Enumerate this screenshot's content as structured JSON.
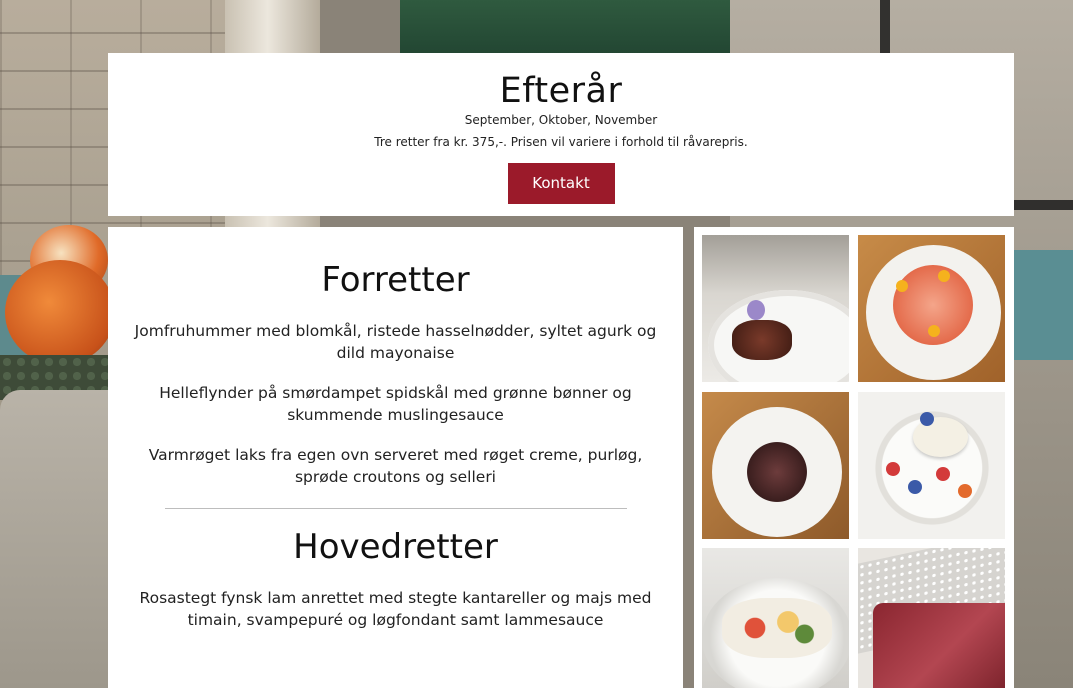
{
  "header": {
    "title": "Efterår",
    "months": "September, Oktober, November",
    "price_text": "Tre retter fra kr. 375,-. Prisen vil variere i forhold til råvarepris.",
    "contact_button": "Kontakt"
  },
  "menu": {
    "starters_heading": "Forretter",
    "starters": [
      "Jomfruhummer med blomkål, ristede hasselnødder, syltet agurk og dild mayonaise",
      "Helleflynder på smørdampet spidskål med grønne bønner og skummende muslingesauce",
      "Varmrøget laks fra egen ovn serveret med røget creme, purløg, sprøde croutons og selleri"
    ],
    "mains_heading": "Hovedretter",
    "mains": [
      "Rosastegt fynsk lam anrettet med stegte kantareller og majs med timain, svampepuré og løgfondant samt lammesauce"
    ]
  },
  "colors": {
    "accent_button": "#9b1a2a",
    "card_background": "#ffffff"
  },
  "gallery": {
    "photos": [
      "dessert-photo",
      "salmon-photo",
      "dessert-photo",
      "berry-dessert-photo",
      "salad-bowl-photo",
      "beef-photo"
    ]
  }
}
